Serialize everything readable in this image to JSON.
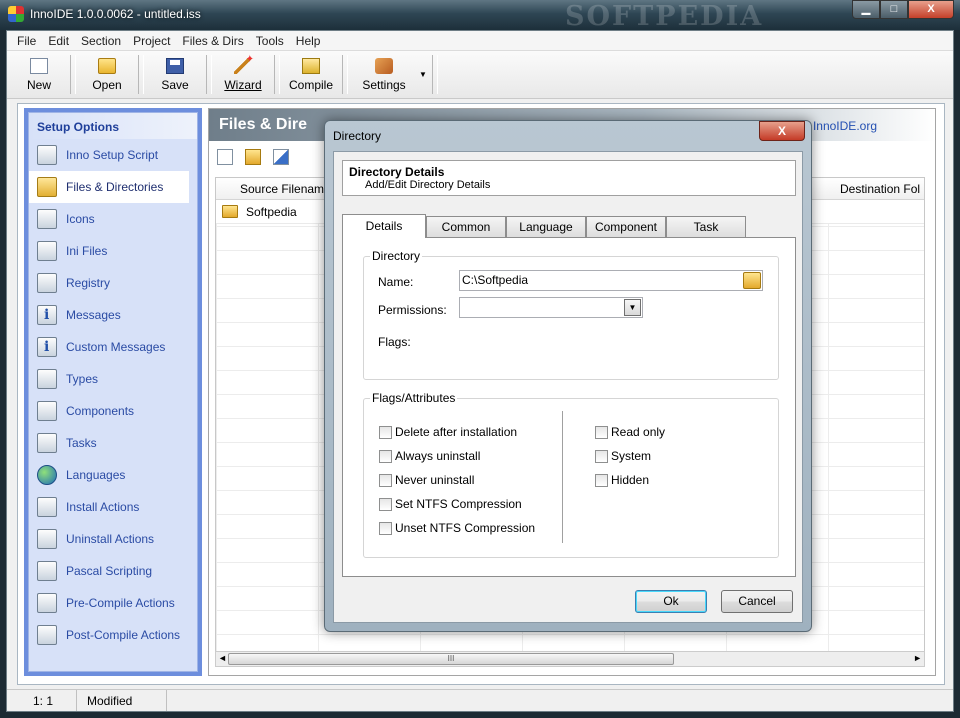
{
  "window": {
    "title": "InnoIDE 1.0.0.0062 - untitled.iss",
    "watermark": "SOFTPEDIA",
    "min_label": "▁",
    "max_label": "□",
    "close_label": "X"
  },
  "menu": [
    "File",
    "Edit",
    "Section",
    "Project",
    "Files & Dirs",
    "Tools",
    "Help"
  ],
  "toolbar": {
    "new": "New",
    "open": "Open",
    "save": "Save",
    "wizard": "Wizard",
    "compile": "Compile",
    "settings": "Settings",
    "dropdown": "▼"
  },
  "sidebar": {
    "title": "Setup Options",
    "items": [
      {
        "label": "Inno Setup Script"
      },
      {
        "label": "Files & Directories"
      },
      {
        "label": "Icons"
      },
      {
        "label": "Ini Files"
      },
      {
        "label": "Registry"
      },
      {
        "label": "Messages"
      },
      {
        "label": "Custom Messages"
      },
      {
        "label": "Types"
      },
      {
        "label": "Components"
      },
      {
        "label": "Tasks"
      },
      {
        "label": "Languages"
      },
      {
        "label": "Install Actions"
      },
      {
        "label": "Uninstall Actions"
      },
      {
        "label": "Pascal Scripting"
      },
      {
        "label": "Pre-Compile Actions"
      },
      {
        "label": "Post-Compile Actions"
      }
    ]
  },
  "content": {
    "title": "Files & Dire",
    "link": "InnoIDE.org",
    "columns": {
      "source": "Source Filenam",
      "destination": "Destination Fol"
    },
    "rows": [
      {
        "source": "Softpedia"
      }
    ],
    "scroll_thumb": "III",
    "scroll_left": "◄",
    "scroll_right": "►"
  },
  "dialog": {
    "title": "Directory",
    "close_label": "X",
    "header_title": "Directory Details",
    "header_sub": "Add/Edit Directory Details",
    "tabs": [
      "Details",
      "Common",
      "Language",
      "Component",
      "Task"
    ],
    "directory_group": "Directory",
    "name_label": "Name:",
    "name_value": "C:\\Softpedia",
    "permissions_label": "Permissions:",
    "permissions_value": "",
    "combo_arrow": "▼",
    "flags_label": "Flags:",
    "attributes_group": "Flags/Attributes",
    "checks_left": [
      "Delete after installation",
      "Always uninstall",
      "Never uninstall",
      "Set NTFS Compression",
      "Unset NTFS Compression"
    ],
    "checks_right": [
      "Read only",
      "System",
      "Hidden"
    ],
    "ok": "Ok",
    "cancel": "Cancel"
  },
  "status": {
    "position": "1:  1",
    "state": "Modified"
  }
}
